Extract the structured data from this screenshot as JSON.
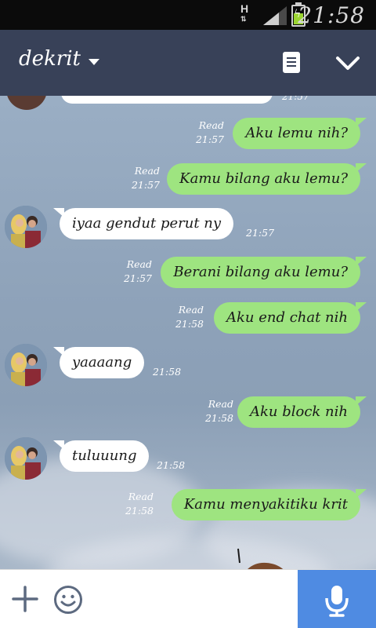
{
  "status_bar": {
    "network": "H",
    "network_arrows": "⇅",
    "time": "21:58",
    "battery_color": "#9bd531"
  },
  "header": {
    "title": "dekrit",
    "dropdown_icon": "caret-down-icon",
    "note_icon": "note-icon",
    "close_icon": "check-icon",
    "background": "#384158"
  },
  "partial_top": {
    "time": "21:57"
  },
  "messages": [
    {
      "dir": "out",
      "text": "Aku lemu nih?",
      "read": "Read",
      "time": "21:57"
    },
    {
      "dir": "out",
      "text": "Kamu bilang aku lemu?",
      "read": "Read",
      "time": "21:57"
    },
    {
      "dir": "in",
      "text": "iyaa gendut perut ny",
      "time": "21:57"
    },
    {
      "dir": "out",
      "text": "Berani bilang aku lemu?",
      "read": "Read",
      "time": "21:57"
    },
    {
      "dir": "out",
      "text": "Aku end chat nih",
      "read": "Read",
      "time": "21:58"
    },
    {
      "dir": "in",
      "text": "yaaaang",
      "time": "21:58"
    },
    {
      "dir": "out",
      "text": "Aku block nih",
      "read": "Read",
      "time": "21:58"
    },
    {
      "dir": "in",
      "text": "tuluuung",
      "time": "21:58"
    },
    {
      "dir": "out",
      "text": "Kamu menyakitiku krit",
      "read": "Read",
      "time": "21:58"
    }
  ],
  "input_bar": {
    "add_icon": "plus-icon",
    "emoji_icon": "smiley-icon",
    "placeholder": "",
    "mic_icon": "microphone-icon",
    "mic_color": "#4f8be2"
  },
  "colors": {
    "outgoing_bubble": "#9ee480",
    "incoming_bubble": "#ffffff"
  }
}
